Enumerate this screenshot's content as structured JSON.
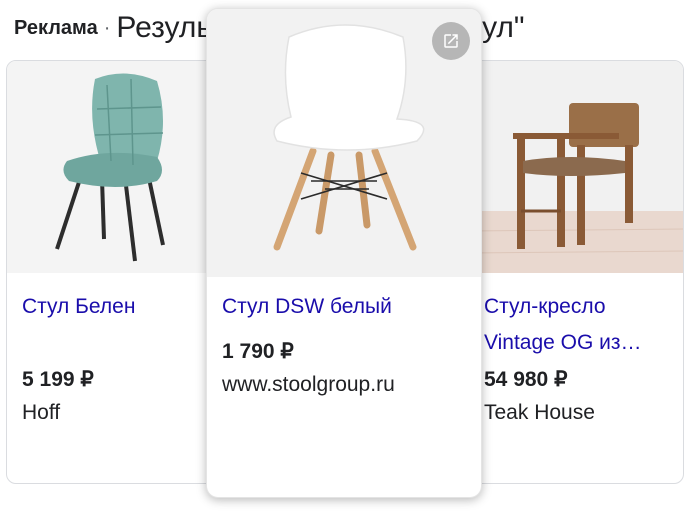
{
  "header": {
    "ad_label": "Реклама",
    "separator": "·",
    "results_title": "Результаты по запросу \"стул\""
  },
  "products": [
    {
      "name": "Стул Белен",
      "price": "5 199 ₽",
      "seller": "Hoff",
      "image_icon": "teal-upholstered-chair"
    },
    {
      "name": "Стул DSW белый",
      "price": "1 790 ₽",
      "seller": "www.stoolgroup.ru",
      "image_icon": "white-plastic-chair-wooden-legs",
      "action_icon": "open-external-icon"
    },
    {
      "name": "Стул-кресло Vintage OG из…",
      "name_line1": "Стул-кресло",
      "name_line2": "Vintage OG из…",
      "price": "54 980 ₽",
      "seller": "Teak House",
      "image_icon": "wooden-armchair-leather-seat"
    }
  ],
  "colors": {
    "link": "#1a0dab",
    "text": "#202124",
    "border": "#dadce0",
    "ext_button": "#b6b6b6"
  }
}
